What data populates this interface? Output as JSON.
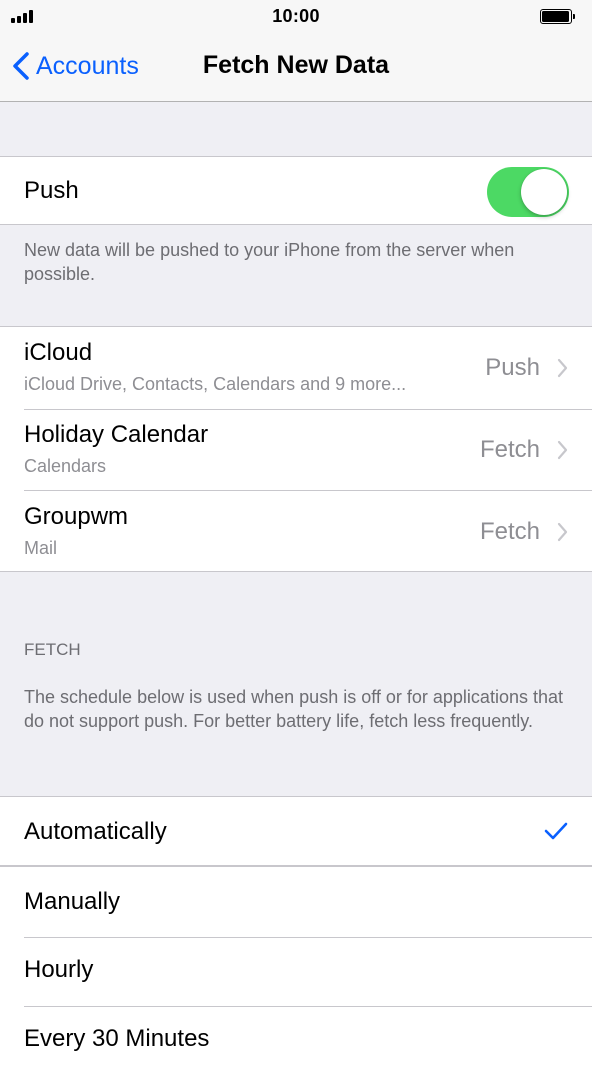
{
  "status_bar": {
    "time": "10:00"
  },
  "nav": {
    "back_label": "Accounts",
    "title": "Fetch New Data"
  },
  "push": {
    "label": "Push",
    "enabled": true,
    "footer": "New data will be pushed to your iPhone from the server when possible."
  },
  "accounts": [
    {
      "name": "iCloud",
      "detail": "iCloud Drive, Contacts, Calendars and 9 more...",
      "value": "Push"
    },
    {
      "name": "Holiday Calendar",
      "detail": "Calendars",
      "value": "Fetch"
    },
    {
      "name": "Groupwm",
      "detail": "Mail",
      "value": "Fetch"
    }
  ],
  "fetch": {
    "header": "FETCH",
    "footer": "The schedule below is used when push is off or for applications that do not support push. For better battery life, fetch less frequently.",
    "options": [
      "Automatically",
      "Manually",
      "Hourly",
      "Every 30 Minutes"
    ],
    "selected": "Automatically"
  },
  "colors": {
    "accent": "#0a60fe",
    "toggle_on": "#4cd964",
    "secondary_text": "#8e8e93"
  },
  "icons": [
    "signal-icon",
    "battery-icon",
    "chevron-left-icon",
    "chevron-right-icon",
    "checkmark-icon"
  ]
}
